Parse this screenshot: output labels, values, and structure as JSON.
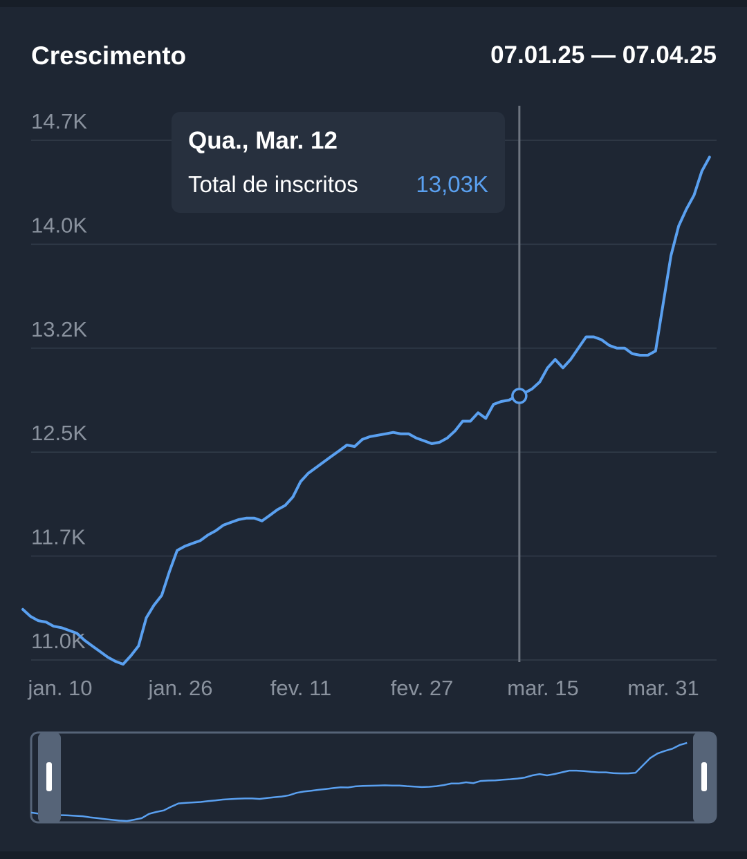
{
  "header": {
    "title": "Crescimento",
    "date_range": "07.01.25 — 07.04.25"
  },
  "tooltip": {
    "date": "Qua., Mar. 12",
    "label": "Total de inscritos",
    "value": "13,03K"
  },
  "colors": {
    "line": "#5aa0f0",
    "background": "#1e2633",
    "grid": "#333d4b",
    "axis_text": "#8a929e",
    "cursor": "#6e7580",
    "navigator": "#566478"
  },
  "chart_data": {
    "type": "line",
    "title": "Crescimento",
    "ylabel": "",
    "xlabel": "",
    "x_start": "2025-01-07",
    "x_end": "2025-04-07",
    "ylim": [
      11.0,
      14.7
    ],
    "y_ticks": [
      "14.7K",
      "14.0K",
      "13.2K",
      "12.5K",
      "11.7K",
      "11.0K"
    ],
    "x_ticks": [
      "jan. 10",
      "jan. 26",
      "fev. 11",
      "fev. 27",
      "mar. 15",
      "mar. 31"
    ],
    "grid": true,
    "cursor_date": "2025-03-12",
    "series": [
      {
        "values": [
          [
            "2025-01-07",
            11.36
          ],
          [
            "2025-01-08",
            11.31
          ],
          [
            "2025-01-09",
            11.28
          ],
          [
            "2025-01-10",
            11.27
          ],
          [
            "2025-01-11",
            11.24
          ],
          [
            "2025-01-12",
            11.23
          ],
          [
            "2025-01-13",
            11.21
          ],
          [
            "2025-01-14",
            11.19
          ],
          [
            "2025-01-15",
            11.14
          ],
          [
            "2025-01-16",
            11.1
          ],
          [
            "2025-01-17",
            11.06
          ],
          [
            "2025-01-18",
            11.02
          ],
          [
            "2025-01-19",
            10.99
          ],
          [
            "2025-01-20",
            10.97
          ],
          [
            "2025-01-21",
            11.03
          ],
          [
            "2025-01-22",
            11.1
          ],
          [
            "2025-01-23",
            11.3
          ],
          [
            "2025-01-24",
            11.39
          ],
          [
            "2025-01-25",
            11.46
          ],
          [
            "2025-01-26",
            11.63
          ],
          [
            "2025-01-27",
            11.78
          ],
          [
            "2025-01-28",
            11.81
          ],
          [
            "2025-01-29",
            11.83
          ],
          [
            "2025-01-30",
            11.85
          ],
          [
            "2025-01-31",
            11.89
          ],
          [
            "2025-02-01",
            11.92
          ],
          [
            "2025-02-02",
            11.96
          ],
          [
            "2025-02-03",
            11.98
          ],
          [
            "2025-02-04",
            12.0
          ],
          [
            "2025-02-05",
            12.01
          ],
          [
            "2025-02-06",
            12.01
          ],
          [
            "2025-02-07",
            11.99
          ],
          [
            "2025-02-08",
            12.03
          ],
          [
            "2025-02-09",
            12.07
          ],
          [
            "2025-02-10",
            12.1
          ],
          [
            "2025-02-11",
            12.16
          ],
          [
            "2025-02-12",
            12.27
          ],
          [
            "2025-02-13",
            12.33
          ],
          [
            "2025-02-14",
            12.37
          ],
          [
            "2025-02-15",
            12.41
          ],
          [
            "2025-02-16",
            12.45
          ],
          [
            "2025-02-17",
            12.49
          ],
          [
            "2025-02-18",
            12.53
          ],
          [
            "2025-02-19",
            12.52
          ],
          [
            "2025-02-20",
            12.57
          ],
          [
            "2025-02-21",
            12.59
          ],
          [
            "2025-02-22",
            12.6
          ],
          [
            "2025-02-23",
            12.61
          ],
          [
            "2025-02-24",
            12.62
          ],
          [
            "2025-02-25",
            12.61
          ],
          [
            "2025-02-26",
            12.61
          ],
          [
            "2025-02-27",
            12.58
          ],
          [
            "2025-02-28",
            12.56
          ],
          [
            "2025-03-01",
            12.54
          ],
          [
            "2025-03-02",
            12.55
          ],
          [
            "2025-03-03",
            12.58
          ],
          [
            "2025-03-04",
            12.63
          ],
          [
            "2025-03-05",
            12.7
          ],
          [
            "2025-03-06",
            12.7
          ],
          [
            "2025-03-07",
            12.76
          ],
          [
            "2025-03-08",
            12.72
          ],
          [
            "2025-03-09",
            12.82
          ],
          [
            "2025-03-10",
            12.84
          ],
          [
            "2025-03-11",
            12.85
          ],
          [
            "2025-03-12",
            12.88
          ],
          [
            "2025-03-13",
            12.9
          ],
          [
            "2025-03-14",
            12.93
          ],
          [
            "2025-03-15",
            12.98
          ],
          [
            "2025-03-16",
            13.08
          ],
          [
            "2025-03-17",
            13.14
          ],
          [
            "2025-03-18",
            13.08
          ],
          [
            "2025-03-19",
            13.14
          ],
          [
            "2025-03-20",
            13.22
          ],
          [
            "2025-03-21",
            13.3
          ],
          [
            "2025-03-22",
            13.3
          ],
          [
            "2025-03-23",
            13.28
          ],
          [
            "2025-03-24",
            13.24
          ],
          [
            "2025-03-25",
            13.22
          ],
          [
            "2025-03-26",
            13.22
          ],
          [
            "2025-03-27",
            13.18
          ],
          [
            "2025-03-28",
            13.17
          ],
          [
            "2025-03-29",
            13.17
          ],
          [
            "2025-03-30",
            13.2
          ],
          [
            "2025-03-31",
            13.54
          ],
          [
            "2025-04-01",
            13.88
          ],
          [
            "2025-04-02",
            14.09
          ],
          [
            "2025-04-03",
            14.21
          ],
          [
            "2025-04-04",
            14.31
          ],
          [
            "2025-04-05",
            14.48
          ],
          [
            "2025-04-06",
            14.58
          ]
        ]
      }
    ]
  }
}
